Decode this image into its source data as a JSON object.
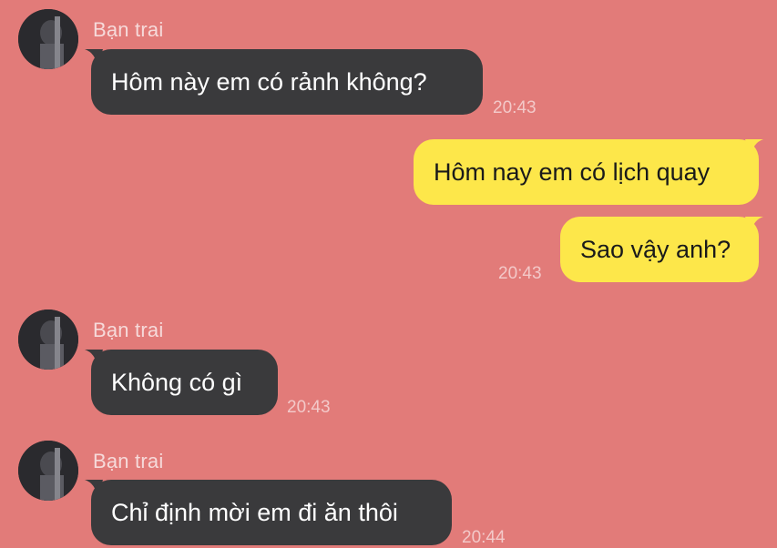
{
  "messages": [
    {
      "side": "left",
      "sender": "Bạn trai",
      "text": "Hôm này em có rảnh không?",
      "time": "20:43"
    },
    {
      "side": "right",
      "text": "Hôm nay em có lịch quay",
      "time": ""
    },
    {
      "side": "right",
      "text": "Sao vậy anh?",
      "time": "20:43"
    },
    {
      "side": "left",
      "sender": "Bạn trai",
      "text": "Không có gì",
      "time": "20:43"
    },
    {
      "side": "left",
      "sender": "Bạn trai",
      "text": "Chỉ định mời em đi ăn thôi",
      "time": "20:44"
    }
  ],
  "colors": {
    "background": "#e27b79",
    "incoming_bubble": "#3a3a3c",
    "outgoing_bubble": "#fde74a"
  }
}
